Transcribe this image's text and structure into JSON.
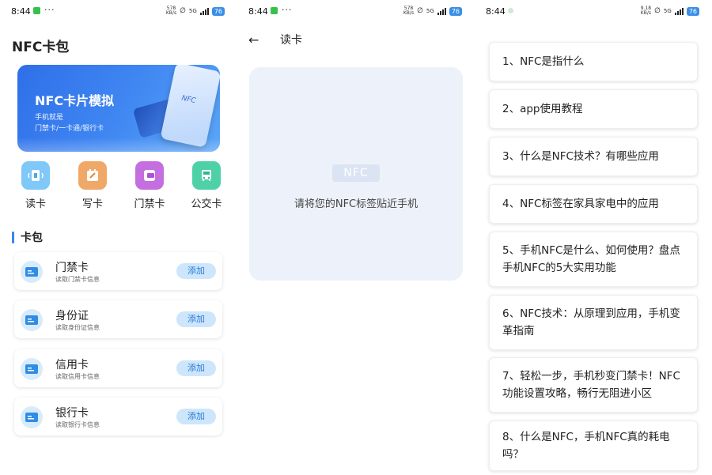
{
  "panel1": {
    "status": {
      "time": "8:44",
      "dots": "···",
      "speed_top": "578",
      "speed_bottom": "KB/s",
      "network": "5G",
      "battery": "76"
    },
    "title": "NFC卡包",
    "banner": {
      "title": "NFC卡片模拟",
      "line1": "手机就是",
      "line2": "门禁卡/一卡通/银行卡",
      "phone_label": "NFC"
    },
    "shortcuts": [
      {
        "label": "读卡",
        "icon": "nfc-read-icon",
        "color": "#7fc8f8"
      },
      {
        "label": "写卡",
        "icon": "write-card-icon",
        "color": "#f0a868"
      },
      {
        "label": "门禁卡",
        "icon": "door-card-icon",
        "color": "#c56ee0"
      },
      {
        "label": "公交卡",
        "icon": "bus-icon",
        "color": "#4fd1a8"
      }
    ],
    "section_title": "卡包",
    "cards": [
      {
        "name": "门禁卡",
        "desc": "读取门禁卡信息",
        "button": "添加"
      },
      {
        "name": "身份证",
        "desc": "读取身份证信息",
        "button": "添加"
      },
      {
        "name": "信用卡",
        "desc": "读取信用卡信息",
        "button": "添加"
      },
      {
        "name": "银行卡",
        "desc": "读取银行卡信息",
        "button": "添加"
      }
    ]
  },
  "panel2": {
    "status": {
      "time": "8:44",
      "dots": "···",
      "speed_top": "578",
      "speed_bottom": "KB/s",
      "network": "5G",
      "battery": "76"
    },
    "title": "读卡",
    "back_icon": "back-arrow-icon",
    "nfc_logo": "NFC",
    "hint": "请将您的NFC标签贴近手机"
  },
  "panel3": {
    "status": {
      "time": "8:44",
      "speed_top": "9.18",
      "speed_bottom": "KB/s",
      "network": "5G",
      "battery": "76"
    },
    "faq": [
      {
        "line1": "1、NFC是指什么"
      },
      {
        "line1": "2、app使用教程"
      },
      {
        "line1": "3、什么是NFC技术？有哪些应用"
      },
      {
        "line1": "4、NFC标签在家具家电中的应用"
      },
      {
        "line1": "5、手机NFC是什么、如何使用？盘点",
        "line2": "手机NFC的5大实用功能"
      },
      {
        "line1": "6、NFC技术：从原理到应用，手机变",
        "line2": "革指南"
      },
      {
        "line1": "7、轻松一步，手机秒变门禁卡！NFC",
        "line2": "功能设置攻略，畅行无阻进小区"
      },
      {
        "line1": "8、什么是NFC，手机NFC真的耗电",
        "line2": "吗？"
      }
    ]
  },
  "colors": {
    "accent": "#3a86ee",
    "button_bg": "#cde6fb",
    "button_text": "#2a7ad6",
    "reader_bg": "#edf2fa"
  }
}
